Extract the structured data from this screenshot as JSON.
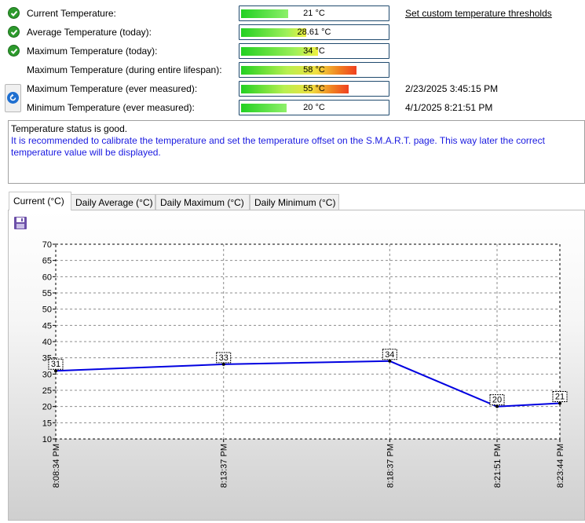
{
  "rows": [
    {
      "label": "Current Temperature:",
      "value": "21 °C",
      "icon": "check-icon",
      "fill_pct": 0.32,
      "fill": "green",
      "extra": "Set custom temperature thresholds"
    },
    {
      "label": "Average Temperature (today):",
      "value": "28.61 °C",
      "icon": "check-icon",
      "fill_pct": 0.44,
      "fill": "green-yellow",
      "extra": ""
    },
    {
      "label": "Maximum Temperature (today):",
      "value": "34 °C",
      "icon": "check-icon",
      "fill_pct": 0.52,
      "fill": "green-yellow",
      "extra": ""
    },
    {
      "label": "Maximum Temperature (during entire lifespan):",
      "value": "58 °C",
      "icon": "",
      "fill_pct": 0.78,
      "fill": "green-red",
      "extra": ""
    },
    {
      "label": "Maximum Temperature (ever measured):",
      "value": "55 °C",
      "icon": "",
      "fill_pct": 0.73,
      "fill": "green-red",
      "extra": "2/23/2025 3:45:15 PM"
    },
    {
      "label": "Minimum Temperature (ever measured):",
      "value": "20 °C",
      "icon": "",
      "fill_pct": 0.31,
      "fill": "green",
      "extra": "4/1/2025 8:21:51 PM"
    }
  ],
  "status": {
    "line1": "Temperature status is good.",
    "line2": "It is recommended to calibrate the temperature and set the temperature offset on the S.M.A.R.T. page. This way later the correct temperature value will be displayed."
  },
  "tabs": [
    {
      "label": "Current (°C)",
      "active": true
    },
    {
      "label": "Daily Average (°C)",
      "active": false
    },
    {
      "label": "Daily Maximum (°C)",
      "active": false
    },
    {
      "label": "Daily Minimum (°C)",
      "active": false
    }
  ],
  "colors": {
    "line": "#0000e0",
    "accent_link": "#000000",
    "tip_text": "#1a1ae0",
    "ok_green": "#2c9a2c"
  },
  "chart_data": {
    "type": "line",
    "x": [
      "8:08:34 PM",
      "8:13:37 PM",
      "8:18:37 PM",
      "8:21:51 PM",
      "8:23:44 PM"
    ],
    "x_minutes": [
      0,
      5.05,
      10.05,
      13.28,
      15.17
    ],
    "values": [
      31,
      33,
      34,
      20,
      21
    ],
    "data_labels": [
      "31",
      "33",
      "34",
      "20",
      "21"
    ],
    "ylim": [
      10,
      70
    ],
    "yticks": [
      10,
      15,
      20,
      25,
      30,
      35,
      40,
      45,
      50,
      55,
      60,
      65,
      70
    ],
    "grid": true
  }
}
